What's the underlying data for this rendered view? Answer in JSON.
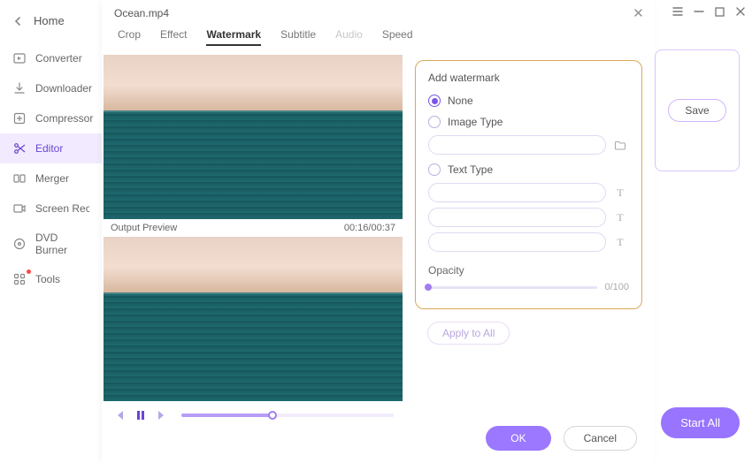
{
  "sidebar": {
    "home": "Home",
    "items": [
      {
        "label": "Converter"
      },
      {
        "label": "Downloader"
      },
      {
        "label": "Compressor"
      },
      {
        "label": "Editor"
      },
      {
        "label": "Merger"
      },
      {
        "label": "Screen Recorder"
      },
      {
        "label": "DVD Burner"
      },
      {
        "label": "Tools"
      }
    ]
  },
  "bg": {
    "save": "Save",
    "start_all": "Start All"
  },
  "modal": {
    "title": "Ocean.mp4",
    "tabs": {
      "crop": "Crop",
      "effect": "Effect",
      "watermark": "Watermark",
      "subtitle": "Subtitle",
      "audio": "Audio",
      "speed": "Speed"
    },
    "preview": {
      "output_label": "Output Preview",
      "time": "00:16/00:37"
    },
    "panel": {
      "title": "Add watermark",
      "none": "None",
      "image_type": "Image Type",
      "text_type": "Text Type",
      "opacity_label": "Opacity",
      "opacity_value": "0/100"
    },
    "apply_all": "Apply to All",
    "ok": "OK",
    "cancel": "Cancel"
  }
}
